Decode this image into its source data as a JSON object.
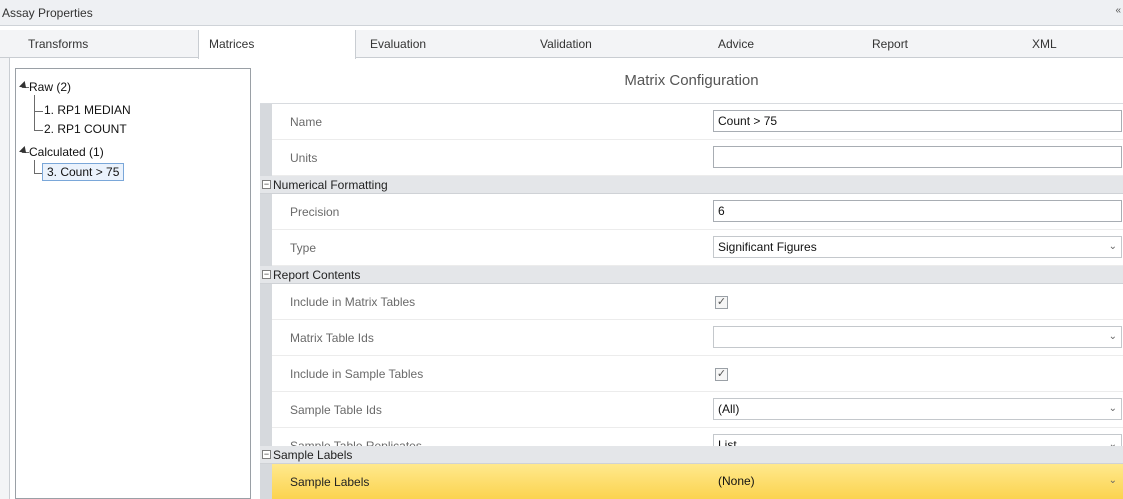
{
  "window": {
    "title": "Assay Properties",
    "corner_glyph": "«"
  },
  "tabs": [
    {
      "label": "Transforms"
    },
    {
      "label": "Matrices"
    },
    {
      "label": "Evaluation"
    },
    {
      "label": "Validation"
    },
    {
      "label": "Advice"
    },
    {
      "label": "Report"
    },
    {
      "label": "XML"
    }
  ],
  "tree": {
    "raw": {
      "label": "Raw (2)",
      "children": [
        "1. RP1 MEDIAN",
        "2. RP1 COUNT"
      ]
    },
    "calculated": {
      "label": "Calculated (1)",
      "children": [
        "3. Count > 75"
      ]
    }
  },
  "config": {
    "title": "Matrix Configuration",
    "name": {
      "label": "Name",
      "value": "Count > 75"
    },
    "units": {
      "label": "Units",
      "value": ""
    },
    "numerical_formatting": {
      "header": "Numerical Formatting",
      "precision": {
        "label": "Precision",
        "value": "6"
      },
      "type": {
        "label": "Type",
        "value": "Significant Figures"
      }
    },
    "report_contents": {
      "header": "Report Contents",
      "include_matrix_tables": {
        "label": "Include in Matrix Tables",
        "checked": "✓"
      },
      "matrix_table_ids": {
        "label": "Matrix Table Ids",
        "value": ""
      },
      "include_sample_tables": {
        "label": "Include in Sample Tables",
        "checked": "✓"
      },
      "sample_table_ids": {
        "label": "Sample Table Ids",
        "value": "(All)"
      },
      "sample_table_replicates": {
        "label": "Sample Table Replicates",
        "value": "List"
      }
    },
    "sample_labels": {
      "header": "Sample Labels",
      "sample_labels": {
        "label": "Sample Labels",
        "value": "(None)"
      }
    }
  },
  "glyphs": {
    "collapse": "−",
    "dropdown": "⌄"
  },
  "colors": {
    "highlight": "#fbd34f",
    "selection_border": "#7aa7d9"
  }
}
